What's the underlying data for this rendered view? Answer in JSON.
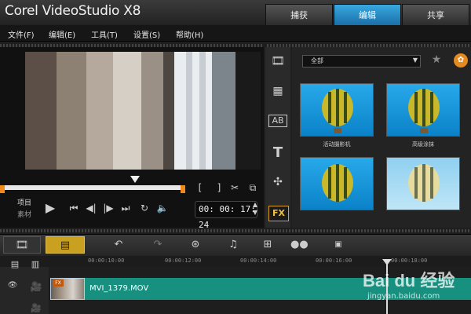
{
  "app": {
    "title": "Corel VideoStudio X8"
  },
  "tabs": [
    {
      "label": "捕获",
      "active": false
    },
    {
      "label": "编辑",
      "active": true
    },
    {
      "label": "共享",
      "active": false
    }
  ],
  "menu": [
    "文件(F)",
    "编辑(E)",
    "工具(T)",
    "设置(S)",
    "帮助(H)"
  ],
  "preview": {
    "mode_labels": [
      "项目",
      "素材"
    ],
    "timecode": "00: 00: 17: 24"
  },
  "library": {
    "category": "全部",
    "items": [
      {
        "label": "活动摄影机"
      },
      {
        "label": "高级涂抹"
      },
      {
        "label": ""
      },
      {
        "label": ""
      }
    ]
  },
  "timeline": {
    "ruler": [
      "00:00:10:00",
      "00:00:12:00",
      "00:00:14:00",
      "00:00:16:00",
      "00:00:18:00"
    ],
    "clip": {
      "name": "MVI_1379.MOV",
      "badge": "FX"
    }
  },
  "watermark": {
    "text": "Bai du 经验",
    "sub": "jingyan.baidu.com"
  },
  "colors": {
    "accent": "#2a9be0",
    "track": "#189080",
    "marker": "#f08a1a"
  }
}
